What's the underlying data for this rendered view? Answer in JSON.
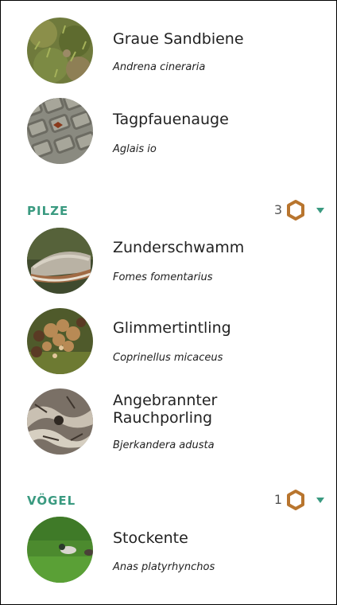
{
  "colors": {
    "section_title": "#3a9a80",
    "hex_badge": "#b8752e",
    "chevron": "#3a9a80"
  },
  "sections": [
    {
      "title": "PILZE",
      "count": "3",
      "badge_icon": "hexagon-icon",
      "toggle_icon": "chevron-down-icon"
    },
    {
      "title": "VÖGEL",
      "count": "1",
      "badge_icon": "hexagon-icon",
      "toggle_icon": "chevron-down-icon"
    }
  ],
  "species": [
    {
      "common": "Graue Sandbiene",
      "scientific": "Andrena cineraria"
    },
    {
      "common": "Tagpfauenauge",
      "scientific": "Aglais io"
    },
    {
      "common": "Zunderschwamm",
      "scientific": "Fomes fomentarius"
    },
    {
      "common": "Glimmertintling",
      "scientific": "Coprinellus micaceus"
    },
    {
      "common": "Angebrannter\nRauchporling",
      "scientific": "Bjerkandera adusta"
    },
    {
      "common": "Stockente",
      "scientific": "Anas platyrhynchos"
    }
  ]
}
